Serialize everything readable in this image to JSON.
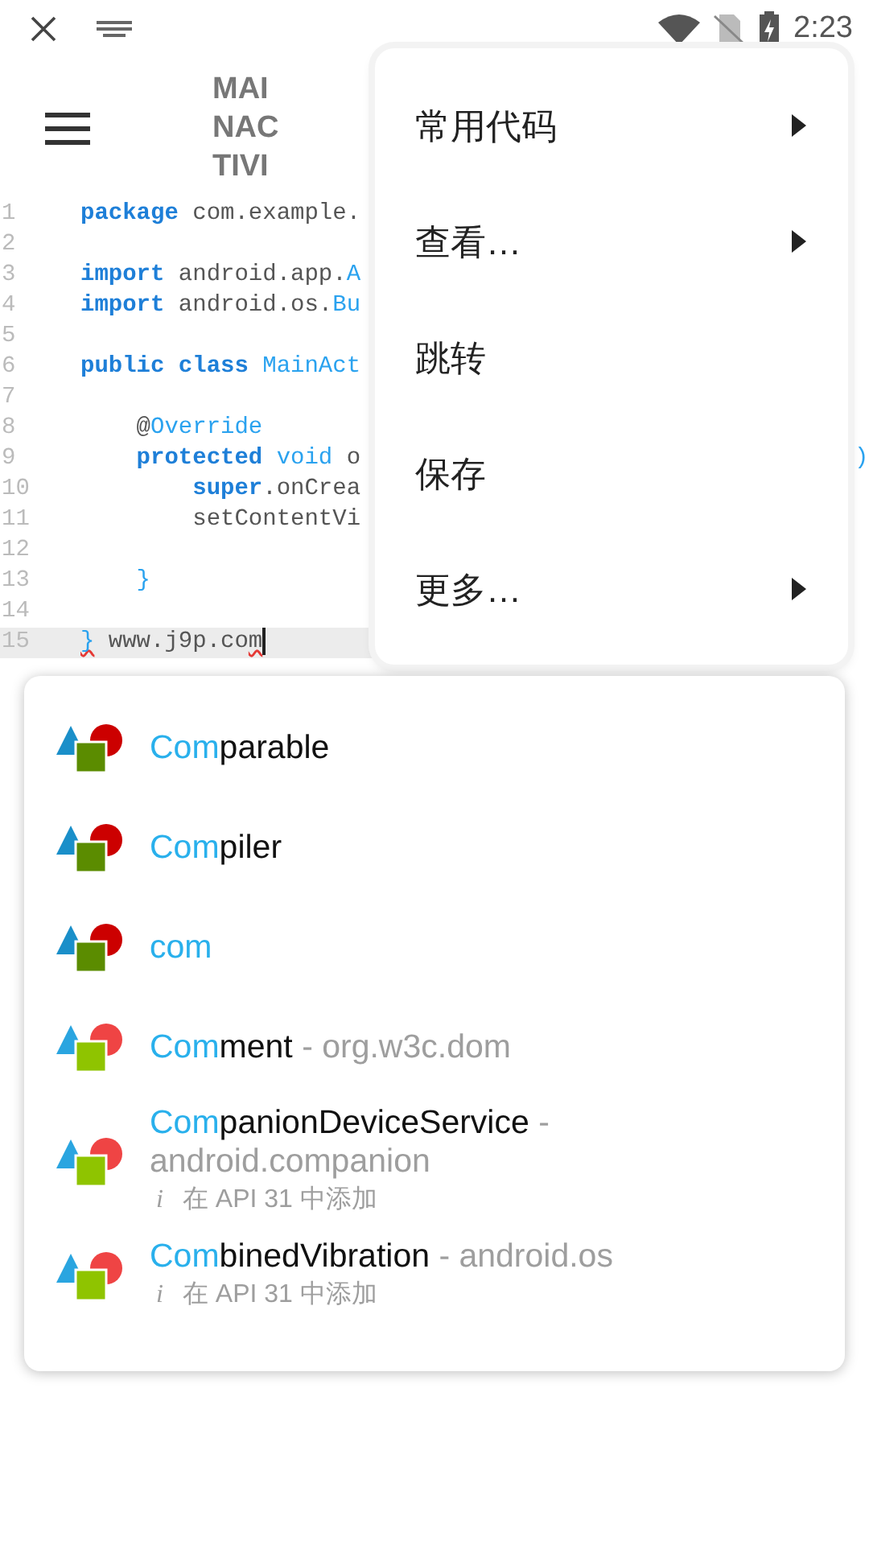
{
  "status_bar": {
    "time": "2:23"
  },
  "toolbar": {
    "title": "MAINACTIVI"
  },
  "editor": {
    "lines": [
      {
        "number": "1",
        "tokens": [
          {
            "kind": "keyword",
            "text": "package"
          },
          {
            "kind": "plain",
            "text": " com.example."
          }
        ]
      },
      {
        "number": "2"
      },
      {
        "number": "3",
        "tokens": [
          {
            "kind": "keyword",
            "text": "import"
          },
          {
            "kind": "plain",
            "text": " android.app."
          },
          {
            "kind": "type",
            "text": "A"
          }
        ]
      },
      {
        "number": "4",
        "tokens": [
          {
            "kind": "keyword",
            "text": "import"
          },
          {
            "kind": "plain",
            "text": " android.os."
          },
          {
            "kind": "type",
            "text": "Bu"
          }
        ]
      },
      {
        "number": "5"
      },
      {
        "number": "6",
        "tokens": [
          {
            "kind": "keyword",
            "text": "public class"
          },
          {
            "kind": "type",
            "text": " MainAct"
          }
        ]
      },
      {
        "number": "7"
      },
      {
        "number": "8",
        "tokens": [
          {
            "kind": "plain",
            "text": "    @"
          },
          {
            "kind": "type",
            "text": "Override"
          }
        ]
      },
      {
        "number": "9",
        "tokens": [
          {
            "kind": "keyword",
            "text": "    protected"
          },
          {
            "kind": "type",
            "text": " void"
          },
          {
            "kind": "plain",
            "text": " o"
          }
        ],
        "tail": ")"
      },
      {
        "number": "10",
        "tokens": [
          {
            "kind": "keyword",
            "text": "        super"
          },
          {
            "kind": "plain",
            "text": ".onCrea"
          }
        ]
      },
      {
        "number": "11",
        "tokens": [
          {
            "kind": "plain",
            "text": "        setContentVi"
          }
        ]
      },
      {
        "number": "12"
      },
      {
        "number": "13",
        "tokens": [
          {
            "kind": "type",
            "text": "    }"
          }
        ]
      },
      {
        "number": "14"
      },
      {
        "number": "15",
        "current": true,
        "tokens": [
          {
            "kind": "type",
            "text": "}",
            "error": true
          },
          {
            "kind": "plain",
            "text": " www.j9p.co"
          },
          {
            "kind": "plain",
            "text": "m",
            "error": true
          }
        ]
      }
    ]
  },
  "menu": {
    "items": [
      {
        "label": "常用代码",
        "submenu": true
      },
      {
        "label": "查看…",
        "submenu": true
      },
      {
        "label": "跳转",
        "submenu": false
      },
      {
        "label": "保存",
        "submenu": false
      },
      {
        "label": "更多…",
        "submenu": true
      }
    ]
  },
  "completions": [
    {
      "kind": "dark",
      "match": "Com",
      "rest": "parable"
    },
    {
      "kind": "dark",
      "match": "Com",
      "rest": "piler"
    },
    {
      "kind": "dark",
      "match": "com"
    },
    {
      "kind": "bright",
      "match": "Com",
      "rest": "ment",
      "package": "- org.w3c.dom"
    },
    {
      "kind": "bright",
      "match": "Com",
      "rest": "panionDeviceService",
      "package": "- android.companion",
      "note_icon": "i",
      "note": "在 API 31 中添加"
    },
    {
      "kind": "bright",
      "match": "Com",
      "rest": "binedVibration",
      "package": "- android.os",
      "note_icon": "i",
      "note": "在 API 31 中添加"
    }
  ]
}
